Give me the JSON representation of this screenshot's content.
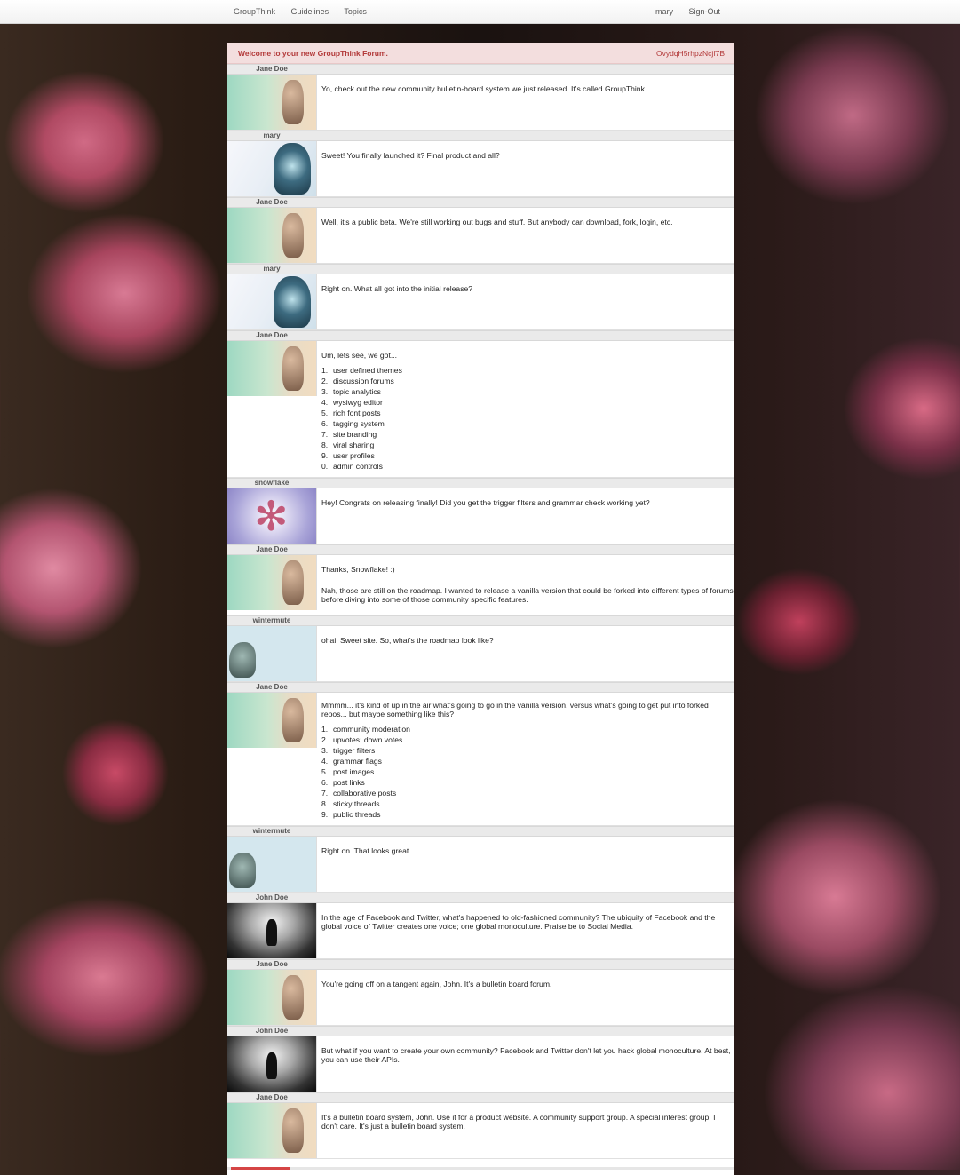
{
  "nav": {
    "left": [
      "GroupThink",
      "Guidelines",
      "Topics"
    ],
    "right": [
      "mary",
      "Sign-Out"
    ]
  },
  "welcome": {
    "title": "Welcome to your new GroupThink Forum.",
    "code": "OvydqH5rhpzNcjf7B"
  },
  "posts": [
    {
      "author": "Jane Doe",
      "paragraphs": [
        "Yo, check out the new community bulletin-board system we just released.  It's called GroupThink."
      ]
    },
    {
      "author": "mary",
      "paragraphs": [
        "Sweet!  You finally launched it?  Final product and all?"
      ]
    },
    {
      "author": "Jane Doe",
      "paragraphs": [
        "Well, it's a public beta.  We're still working out bugs and stuff.  But anybody can download, fork, login, etc."
      ]
    },
    {
      "author": "mary",
      "paragraphs": [
        "Right on.  What all got into the initial release?"
      ]
    },
    {
      "author": "Jane Doe",
      "paragraphs": [
        "Um, lets see, we got..."
      ],
      "list_numbers": [
        "1.",
        "2.",
        "3.",
        "4.",
        "5.",
        "6.",
        "7.",
        "8.",
        "9.",
        "0."
      ],
      "list": [
        "user defined themes",
        "discussion forums",
        "topic analytics",
        "wysiwyg editor",
        "rich font posts",
        "tagging system",
        "site branding",
        "viral sharing",
        "user profiles",
        "admin controls"
      ]
    },
    {
      "author": "snowflake",
      "paragraphs": [
        "Hey!  Congrats on releasing finally!  Did you get the trigger filters and grammar check working yet?"
      ]
    },
    {
      "author": "Jane Doe",
      "paragraphs": [
        "Thanks, Snowflake!  :)",
        "Nah, those are still on the roadmap.  I wanted to release a vanilla version that could be forked into different types of forums before diving into some of those community specific features."
      ]
    },
    {
      "author": "wintermute",
      "paragraphs": [
        "ohai!  Sweet site.   So, what's the roadmap look like?"
      ]
    },
    {
      "author": "Jane Doe",
      "paragraphs": [
        "Mmmm...  it's kind of up in the air what's going to go in the vanilla version, versus what's going to get put into forked repos...  but maybe something like this?"
      ],
      "list_numbers": [
        "1.",
        "2.",
        "3.",
        "4.",
        "5.",
        "6.",
        "7.",
        "8.",
        "9."
      ],
      "list": [
        "community moderation",
        "upvotes; down votes",
        "trigger filters",
        "grammar flags",
        "post images",
        "post links",
        "collaborative posts",
        "sticky threads",
        "public threads"
      ]
    },
    {
      "author": "wintermute",
      "paragraphs": [
        "Right on.  That looks great."
      ]
    },
    {
      "author": "John Doe",
      "paragraphs": [
        "In the age of Facebook and Twitter, what's happened to old-fashioned community?  The ubiquity of Facebook and the global voice of Twitter creates one voice; one global monoculture.  Praise be to Social Media."
      ]
    },
    {
      "author": "Jane Doe",
      "paragraphs": [
        "You're going off on a tangent again, John.  It's a bulletin board forum."
      ]
    },
    {
      "author": "John Doe",
      "paragraphs": [
        "But what if you want to create your own community?   Facebook and Twitter don't let you hack global monoculture.  At best, you can use their APIs."
      ]
    },
    {
      "author": "Jane Doe",
      "paragraphs": [
        "It's a bulletin board system, John.  Use it for a product website.  A community support group.  A special interest group.  I don't care.  It's just a bulletin board system."
      ]
    }
  ]
}
